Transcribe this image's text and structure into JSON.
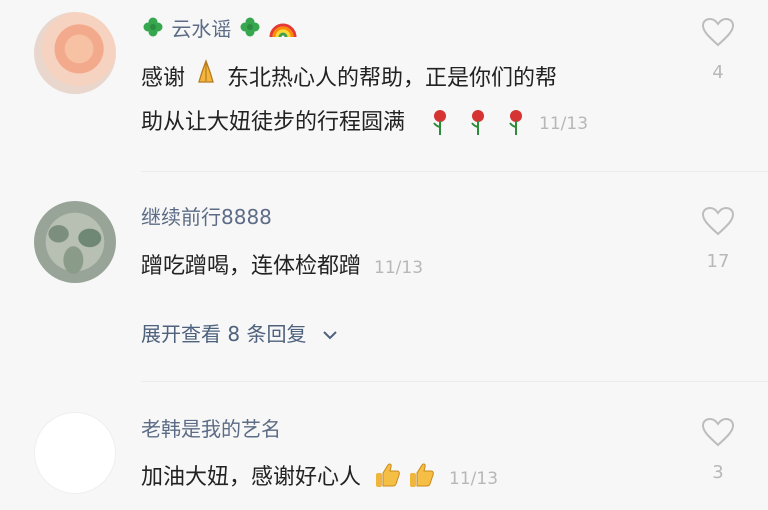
{
  "comments": [
    {
      "username": "云水谣",
      "line1_pre": "感谢",
      "line1_post": "东北热心人的帮助，正是你们的帮",
      "line2": "助从让大妞徒步的行程圆满",
      "date": "11/13",
      "likes": "4"
    },
    {
      "username": "继续前行8888",
      "text": "蹭吃蹭喝，连体检都蹭",
      "date": "11/13",
      "likes": "17",
      "expand_label": "展开查看 8 条回复"
    },
    {
      "username": "老韩是我的艺名",
      "text": "加油大妞，感谢好心人",
      "date": "11/13",
      "likes": "3"
    }
  ],
  "icons": {
    "clover": "four-leaf-clover-icon",
    "rainbow": "rainbow-icon",
    "pray": "folded-hands-icon",
    "rose": "rose-icon",
    "thumb": "thumbs-up-icon",
    "heart": "heart-outline-icon",
    "chevron": "chevron-down-icon"
  },
  "colors": {
    "name": "#5c6c86",
    "expand": "#4e617d",
    "muted": "#b8b8b8",
    "text": "#222222"
  }
}
